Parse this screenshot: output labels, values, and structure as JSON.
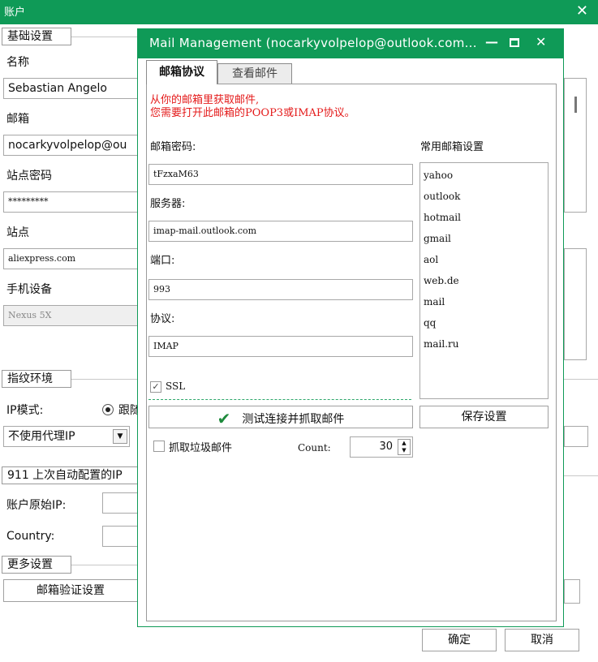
{
  "main": {
    "title": "账户",
    "basic_group": "基础设置",
    "name_label": "名称",
    "name_value": "Sebastian Angelo",
    "email_label": "邮箱",
    "email_value": "nocarkyvolpelop@ou",
    "site_password_label": "站点密码",
    "site_password_value": "*********",
    "site_label": "站点",
    "site_value": "aliexpress.com",
    "device_label": "手机设备",
    "device_value": "Nexus 5X",
    "fingerprint_group": "指纹环境",
    "ip_mode_label": "IP模式:",
    "ip_mode_option": "跟随",
    "proxy_select": "不使用代理IP",
    "auto_config_group": "911 上次自动配置的IP",
    "original_ip_label": "账户原始IP:",
    "country_label": "Country:",
    "more_group": "更多设置",
    "email_verify_button": "邮箱验证设置",
    "ok_button": "确定",
    "cancel_button": "取消"
  },
  "dialog": {
    "title": "Mail Management (nocarkyvolpelop@outlook.com...",
    "tabs": [
      {
        "label": "邮箱协议",
        "active": true
      },
      {
        "label": "查看邮件",
        "active": false
      }
    ],
    "hint_line1": "从你的邮箱里获取邮件,",
    "hint_line2": "您需要打开此邮箱的POOP3或IMAP协议。",
    "password_label": "邮箱密码:",
    "password_value": "tFzxaM63",
    "server_label": "服务器:",
    "server_value": "imap-mail.outlook.com",
    "port_label": "端口:",
    "port_value": "993",
    "protocol_label": "协议:",
    "protocol_value": "IMAP",
    "ssl_label": "SSL",
    "ssl_checked": true,
    "common_settings_label": "常用邮箱设置",
    "common_providers": [
      "yahoo",
      "outlook",
      "hotmail",
      "gmail",
      "aol",
      "web.de",
      "mail",
      "qq",
      "mail.ru"
    ],
    "test_button": "测试连接并抓取邮件",
    "save_button": "保存设置",
    "junk_label": "抓取垃圾邮件",
    "junk_checked": false,
    "count_label": "Count:",
    "count_value": "30"
  },
  "colors": {
    "titlebar": "#0f9a57",
    "hint": "#e41b1b",
    "check": "#1e8a3c"
  }
}
